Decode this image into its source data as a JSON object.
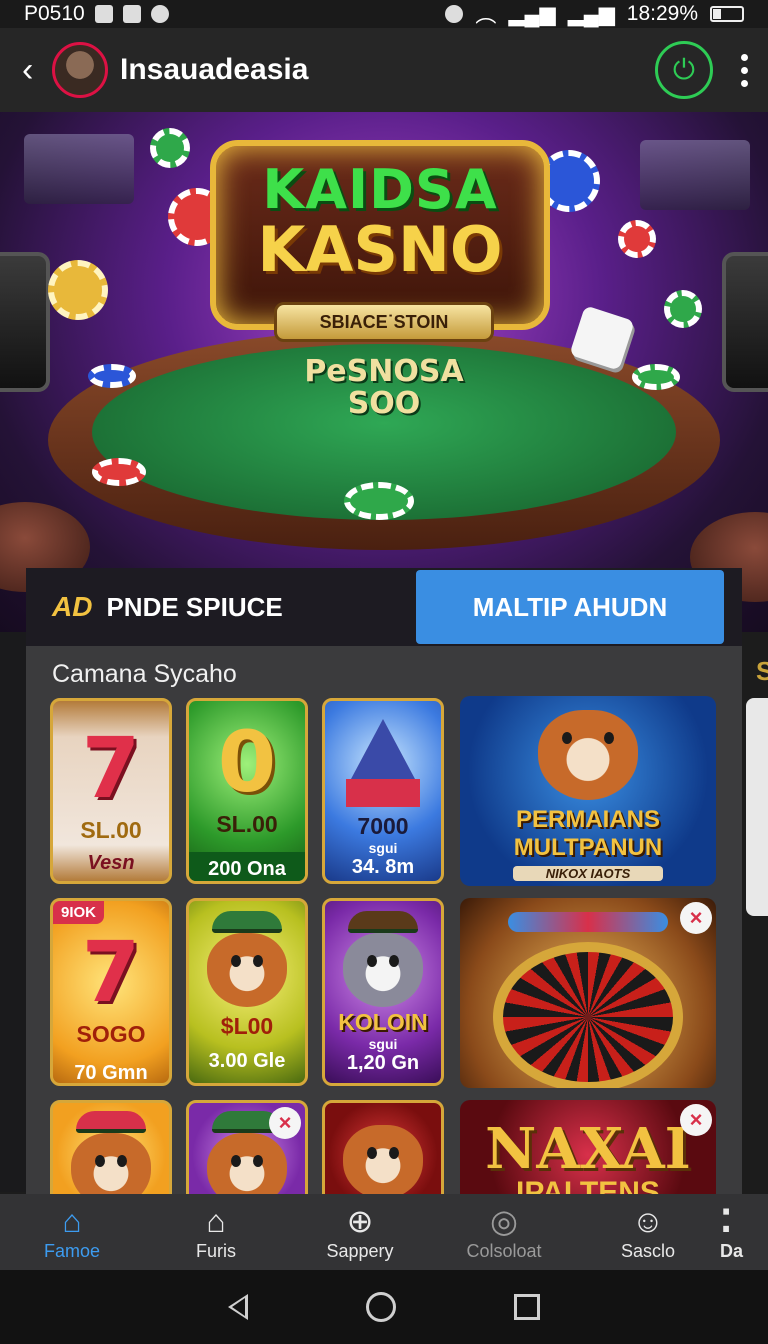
{
  "status_bar": {
    "left_text": "P0510",
    "time_battery": "18:29%"
  },
  "app_bar": {
    "back_icon": "back-arrow-icon",
    "title": "Insauadeasia",
    "power_icon": "power-icon",
    "menu_icon": "more-vert-icon"
  },
  "hero": {
    "logo_top": "KAIDSA",
    "logo_main": "KASNO",
    "logo_ribbon": "SBIACE˙STOIN",
    "table_line1": "PeSNOSA",
    "table_line2": "SOO"
  },
  "tabs": {
    "left_mark": "AD",
    "left_label": "PNDE SPIUCE",
    "right_label": "MALTIP AHUDN"
  },
  "section": {
    "title": "Camana Sycaho",
    "side_peek_letter": "S"
  },
  "tiles": [
    {
      "big": "7",
      "amt": "SL.00",
      "sub": "Vesn"
    },
    {
      "big": "0",
      "amt": "SL.00",
      "sub": "200 Ona"
    },
    {
      "amt": "7000",
      "small": "sgui",
      "sub": "34. 8m"
    },
    {
      "line1": "PERMAIANS",
      "line2": "MULTPANUN",
      "line3": "NIKOX IAOTS"
    },
    {
      "badge": "9IOK",
      "big": "7",
      "amt": "SOGO",
      "sub": "70 Gmn"
    },
    {
      "amt": "$L00",
      "sub": "3.00 Gle"
    },
    {
      "amt": "KOLOIN",
      "small": "sgui",
      "sub": "1,20 Gn"
    },
    {
      "close": "×"
    },
    {
      "close": "×"
    },
    {
      "close": "×"
    },
    {
      "line1": "NAXAI",
      "line2": "IPALTENS"
    }
  ],
  "bottom_nav": [
    {
      "icon": "home-icon",
      "label": "Famoe"
    },
    {
      "icon": "house-icon",
      "label": "Furis"
    },
    {
      "icon": "add-circle-icon",
      "label": "Sappery"
    },
    {
      "icon": "search-icon",
      "label": "Colsoloat"
    },
    {
      "icon": "person-icon",
      "label": "Sasclo"
    },
    {
      "icon": "more-icon",
      "label": "Da"
    }
  ],
  "colors": {
    "accent_blue": "#3a8ee2",
    "power_green": "#2ecc55",
    "gold": "#f2c241"
  }
}
